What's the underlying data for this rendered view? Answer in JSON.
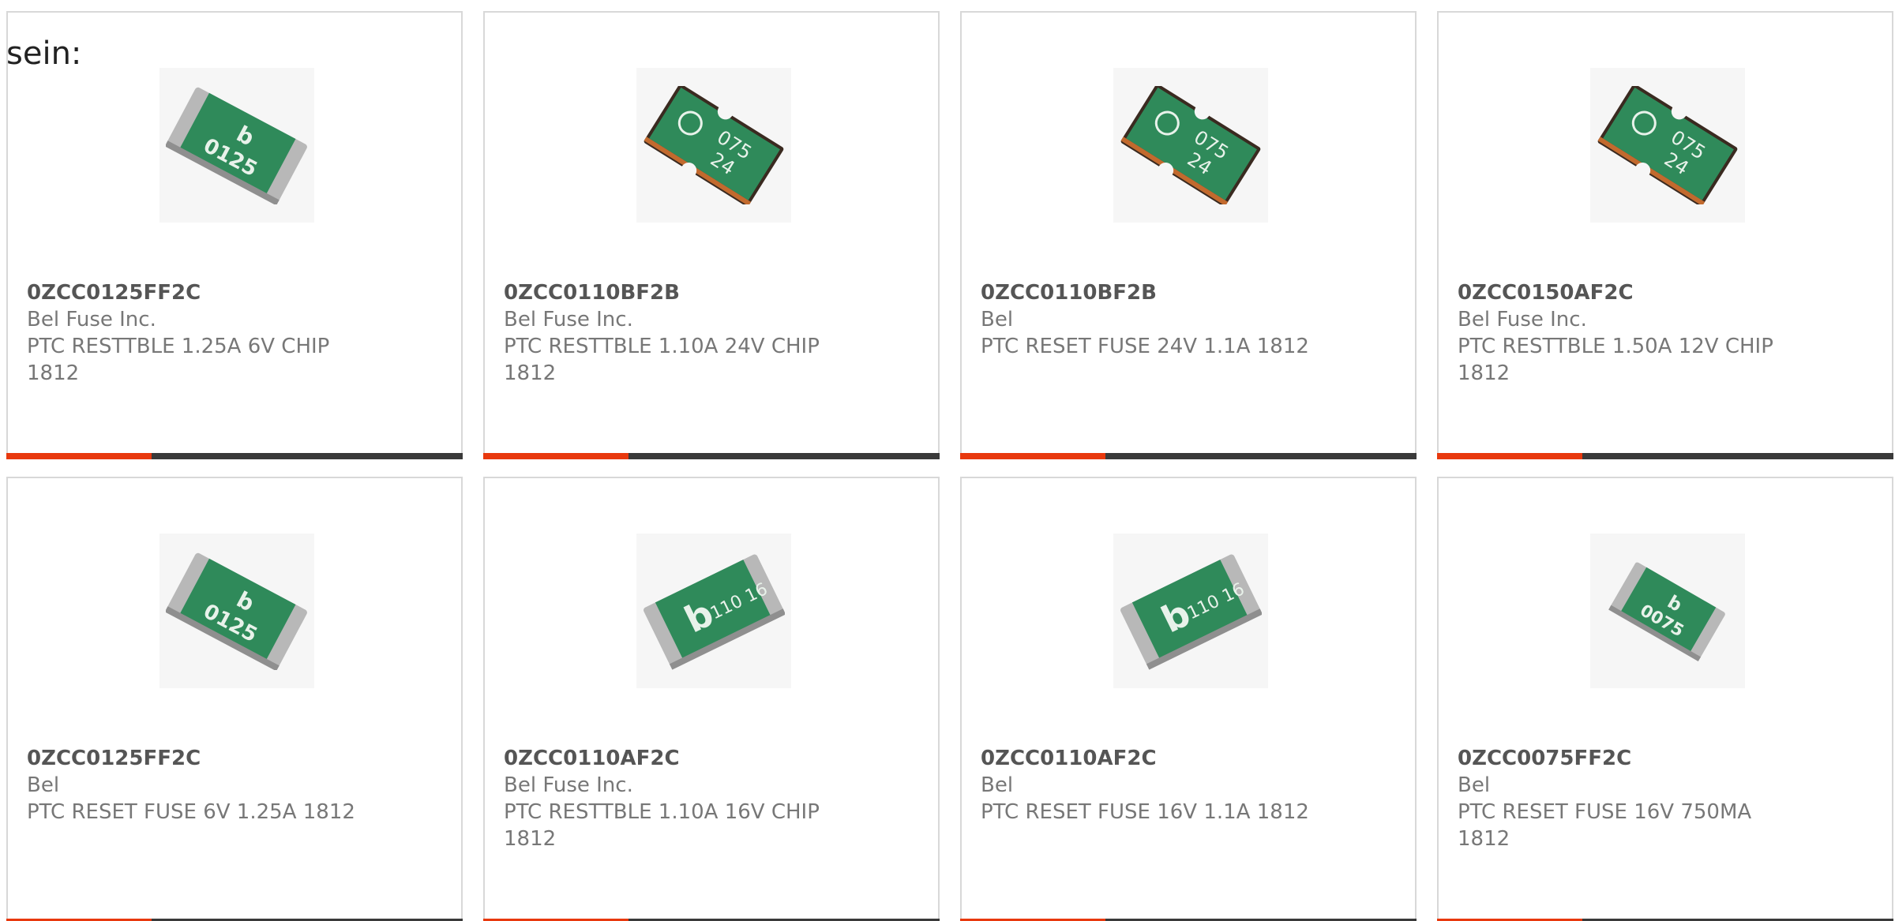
{
  "intro_text": "sein:",
  "colors": {
    "accent": "#e8390e",
    "bar": "#3a3a3a",
    "chip_green": "#2f8a5a",
    "chip_metal": "#b8b8b8"
  },
  "products": [
    {
      "part": "0ZCC0125FF2C",
      "manufacturer": "Bel Fuse Inc.",
      "description": "PTC RESTTBLE 1.25A 6V CHIP 1812",
      "chip_marking_1": "b",
      "chip_marking_2": "0125",
      "icon": "ptc-chip-flat-icon"
    },
    {
      "part": "0ZCC0110BF2B",
      "manufacturer": "Bel Fuse Inc.",
      "description": "PTC RESTTBLE 1.10A 24V CHIP 1812",
      "chip_marking_1": "075",
      "chip_marking_2": "24",
      "icon": "ptc-chip-notched-icon"
    },
    {
      "part": "0ZCC0110BF2B",
      "manufacturer": "Bel",
      "description": "PTC RESET FUSE 24V 1.1A 1812",
      "chip_marking_1": "075",
      "chip_marking_2": "24",
      "icon": "ptc-chip-notched-icon"
    },
    {
      "part": "0ZCC0150AF2C",
      "manufacturer": "Bel Fuse Inc.",
      "description": "PTC RESTTBLE 1.50A 12V CHIP 1812",
      "chip_marking_1": "075",
      "chip_marking_2": "24",
      "icon": "ptc-chip-notched-icon"
    },
    {
      "part": "0ZCC0125FF2C",
      "manufacturer": "Bel",
      "description": "PTC RESET FUSE 6V 1.25A 1812",
      "chip_marking_1": "b",
      "chip_marking_2": "0125",
      "icon": "ptc-chip-flat-icon"
    },
    {
      "part": "0ZCC0110AF2C",
      "manufacturer": "Bel Fuse Inc.",
      "description": "PTC RESTTBLE 1.10A 16V CHIP 1812",
      "chip_marking_1": "b",
      "chip_marking_2": "110 16",
      "icon": "ptc-chip-flat-icon"
    },
    {
      "part": "0ZCC0110AF2C",
      "manufacturer": "Bel",
      "description": "PTC RESET FUSE 16V 1.1A 1812",
      "chip_marking_1": "b",
      "chip_marking_2": "110 16",
      "icon": "ptc-chip-flat-icon"
    },
    {
      "part": "0ZCC0075FF2C",
      "manufacturer": "Bel",
      "description": "PTC RESET FUSE 16V 750MA 1812",
      "chip_marking_1": "b",
      "chip_marking_2": "0075",
      "icon": "ptc-chip-flat-icon"
    }
  ]
}
